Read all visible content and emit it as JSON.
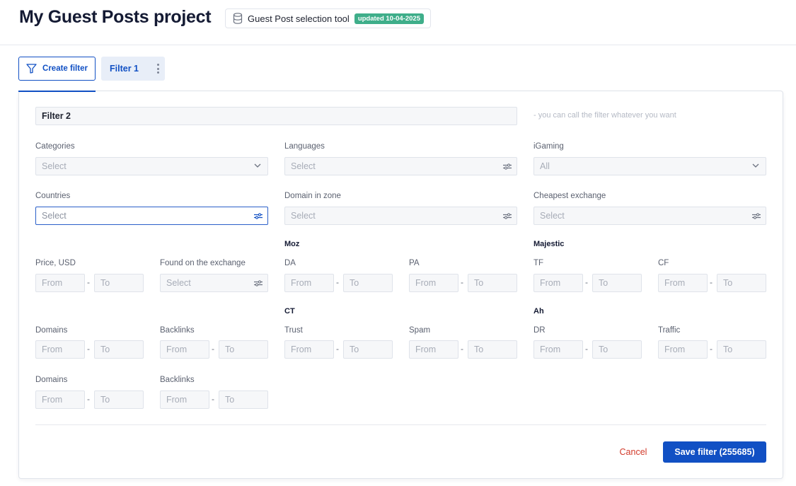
{
  "header": {
    "title": "My Guest Posts project",
    "tool_icon": "database-icon",
    "tool_label": "Guest Post selection tool",
    "updated_badge": "updated 10-04-2025"
  },
  "tabs": {
    "create_filter": "Create filter",
    "create_icon": "funnel-icon",
    "filter1": "Filter 1",
    "filter1_menu_icon": "kebab-icon"
  },
  "filter_form": {
    "name_value": "Filter 2",
    "name_hint": "- you can call the filter whatever you want",
    "categories": {
      "label": "Categories",
      "value": "Select"
    },
    "languages": {
      "label": "Languages",
      "value": "Select"
    },
    "igaming": {
      "label": "iGaming",
      "value": "All"
    },
    "countries": {
      "label": "Countries",
      "value": "Select"
    },
    "domain_zone": {
      "label": "Domain in zone",
      "value": "Select"
    },
    "cheapest_exchange": {
      "label": "Cheapest exchange",
      "value": "Select"
    },
    "price": {
      "label": "Price, USD",
      "from": "From",
      "to": "To"
    },
    "found_exchange": {
      "label": "Found on the exchange",
      "value": "Select"
    },
    "moz": {
      "title": "Moz",
      "da": "DA",
      "pa": "PA"
    },
    "majestic": {
      "title": "Majestic",
      "tf": "TF",
      "cf": "CF"
    },
    "ct": {
      "title": "CT",
      "trust": "Trust",
      "spam": "Spam"
    },
    "ah": {
      "title": "Ah",
      "dr": "DR",
      "traffic": "Traffic"
    },
    "domains": "Domains",
    "backlinks": "Backlinks",
    "from": "From",
    "to": "To",
    "dash": "-"
  },
  "actions": {
    "cancel": "Cancel",
    "save": "Save filter (255685)"
  },
  "colors": {
    "accent": "#1150c4",
    "badge": "#3fae8a",
    "danger": "#d23a2a"
  }
}
